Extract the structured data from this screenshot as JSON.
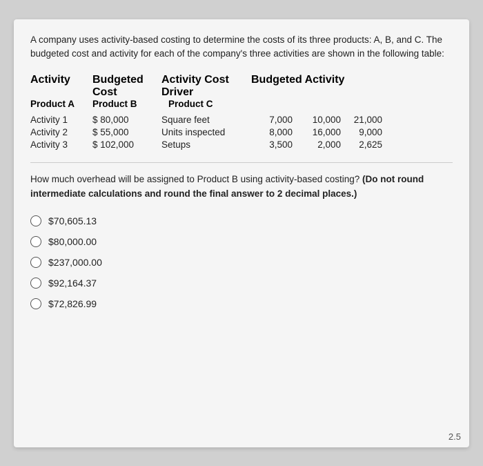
{
  "intro": {
    "text": "A company uses activity-based costing to determine the costs of its three products: A, B, and C. The budgeted cost and activity for each of the company's three activities are shown in the following table:"
  },
  "table": {
    "header1": {
      "col1": "Activity",
      "col2": "Budgeted Cost",
      "col3": "Activity Cost Driver",
      "col4": "Budgeted Activity"
    },
    "header2": {
      "col1": "Product A",
      "col2": "Product B",
      "col3": "Product C"
    },
    "rows": [
      {
        "activity": "Activity 1",
        "cost": "$ 80,000",
        "driver": "Square feet",
        "prodA": "7,000",
        "prodB": "10,000",
        "prodC": "21,000"
      },
      {
        "activity": "Activity 2",
        "cost": "$ 55,000",
        "driver": "Units inspected",
        "prodA": "8,000",
        "prodB": "16,000",
        "prodC": "9,000"
      },
      {
        "activity": "Activity 3",
        "cost": "$ 102,000",
        "driver": "Setups",
        "prodA": "3,500",
        "prodB": "2,000",
        "prodC": "2,625"
      }
    ]
  },
  "question": {
    "text": "How much overhead will be assigned to Product B using activity-based costing? (Do not round intermediate calculations and round the final answer to 2 decimal places.)"
  },
  "options": [
    {
      "label": "$70,605.13"
    },
    {
      "label": "$80,000.00"
    },
    {
      "label": "$237,000.00"
    },
    {
      "label": "$92,164.37"
    },
    {
      "label": "$72,826.99"
    }
  ],
  "page_number": "2.5"
}
